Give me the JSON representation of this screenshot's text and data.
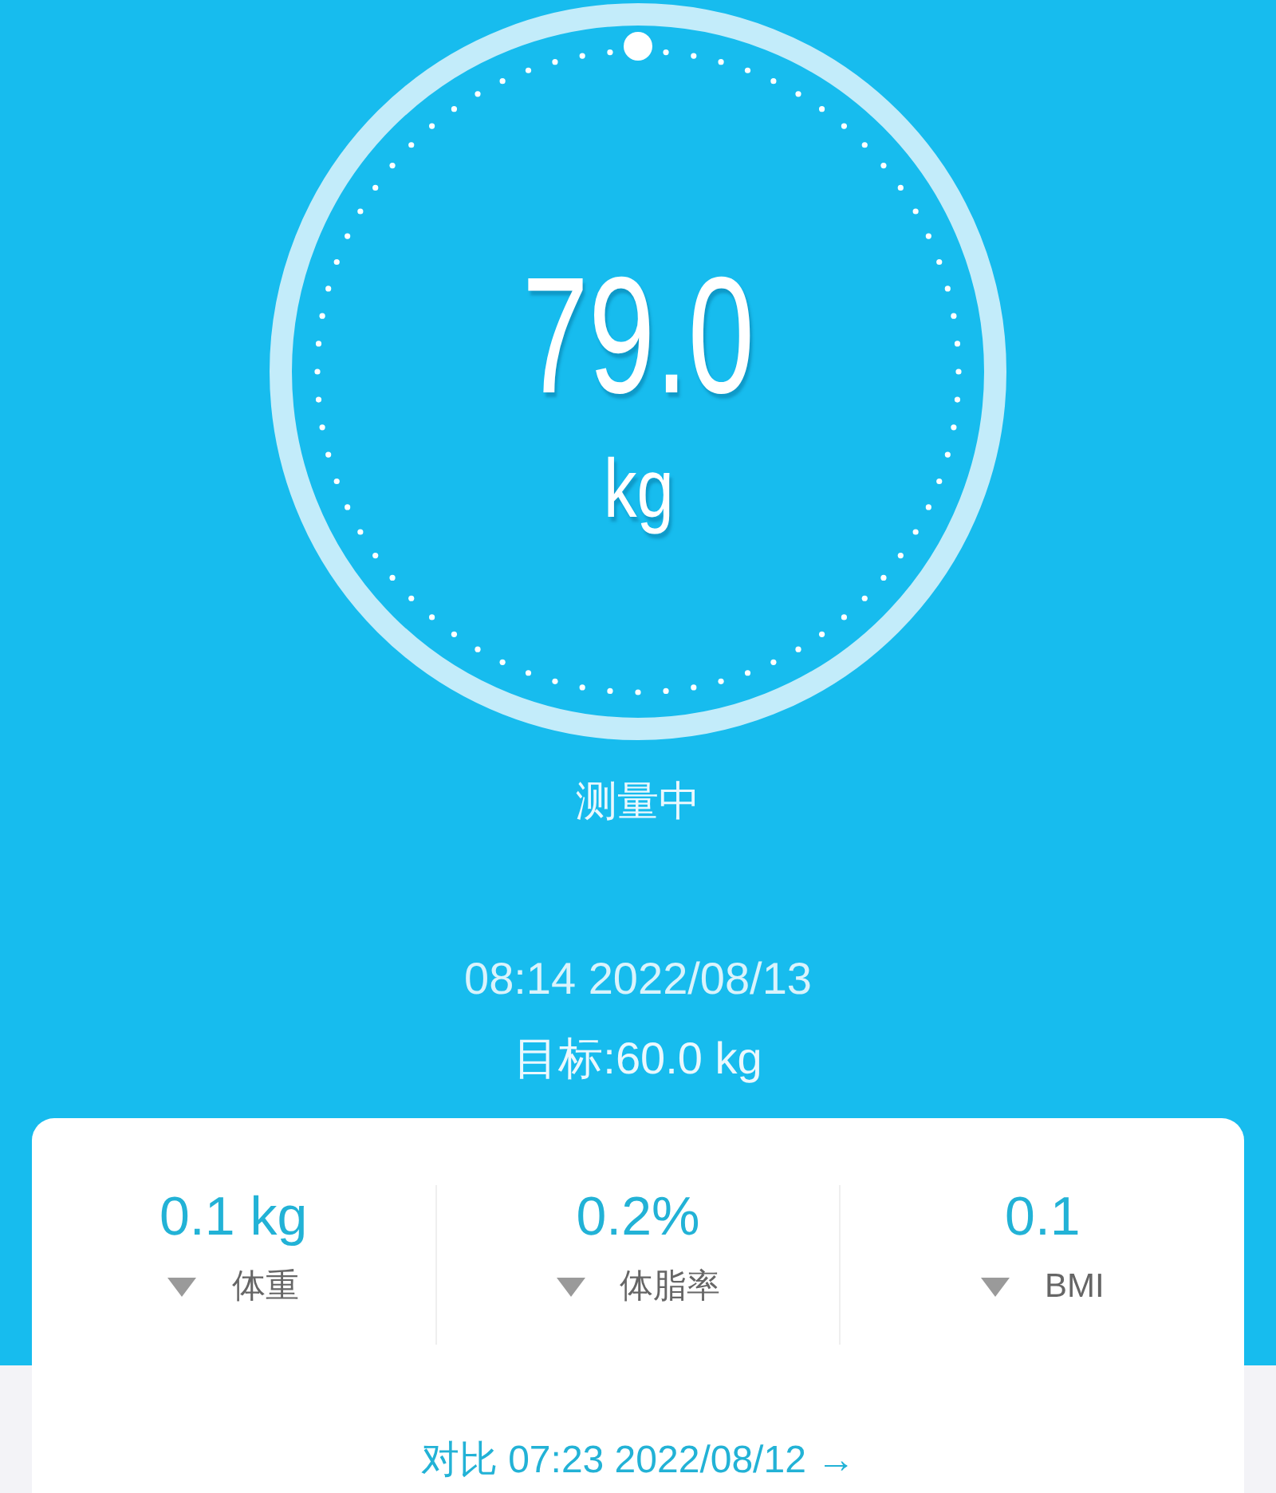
{
  "gauge": {
    "value": "79.0",
    "unit": "kg"
  },
  "status": "测量中",
  "measured_at": "08:14 2022/08/13",
  "target": "目标:60.0 kg",
  "stats": [
    {
      "value": "0.1 kg",
      "kind": "decrease",
      "label": "体重"
    },
    {
      "value": "0.2%",
      "kind": "decrease",
      "label": "体脂率"
    },
    {
      "value": "0.1",
      "kind": "decrease",
      "label": "BMI"
    }
  ],
  "compare_link": {
    "text": "对比 07:23 2022/08/12",
    "arrow": "→"
  }
}
